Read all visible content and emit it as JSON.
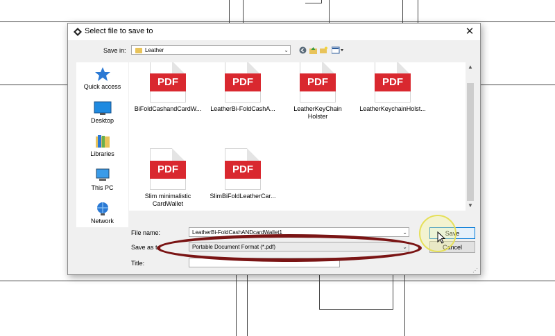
{
  "dialog": {
    "title": "Select file to save to",
    "close_symbol": "✕",
    "save_in": {
      "label": "Save in:",
      "value": "Leather"
    },
    "toolbar": {
      "back_icon": "back-icon",
      "up_icon": "up-folder-icon",
      "new_folder_icon": "new-folder-icon",
      "view_icon": "view-menu-icon"
    }
  },
  "places": [
    {
      "label": "Quick access",
      "icon": "star-icon"
    },
    {
      "label": "Desktop",
      "icon": "desktop-icon"
    },
    {
      "label": "Libraries",
      "icon": "libraries-icon"
    },
    {
      "label": "This PC",
      "icon": "computer-icon"
    },
    {
      "label": "Network",
      "icon": "network-icon"
    }
  ],
  "files": [
    {
      "badge": "PDF",
      "name": "BiFoldCashandCardW..."
    },
    {
      "badge": "PDF",
      "name": "LeatherBi-FoldCashA..."
    },
    {
      "badge": "PDF",
      "name": "LeatherKeyChain Holster"
    },
    {
      "badge": "PDF",
      "name": "LeatherKeychainHolst..."
    },
    {
      "badge": "PDF",
      "name": "Slim minimalistic CardWallet"
    },
    {
      "badge": "PDF",
      "name": "SlimBiFoldLeatherCar..."
    }
  ],
  "form": {
    "file_name_label": "File name:",
    "file_name_value": "LeatherBi-FoldCashANDcardWallet1",
    "save_as_type_label": "Save as t",
    "save_as_type_value": "Portable Document Format (*.pdf)",
    "title_label": "Title:",
    "title_value": ""
  },
  "buttons": {
    "save": "Save",
    "cancel": "Cancel"
  },
  "colors": {
    "pdf_red": "#d9282f",
    "annotation_ellipse": "#7a1414",
    "highlight": "#e6e05a"
  }
}
